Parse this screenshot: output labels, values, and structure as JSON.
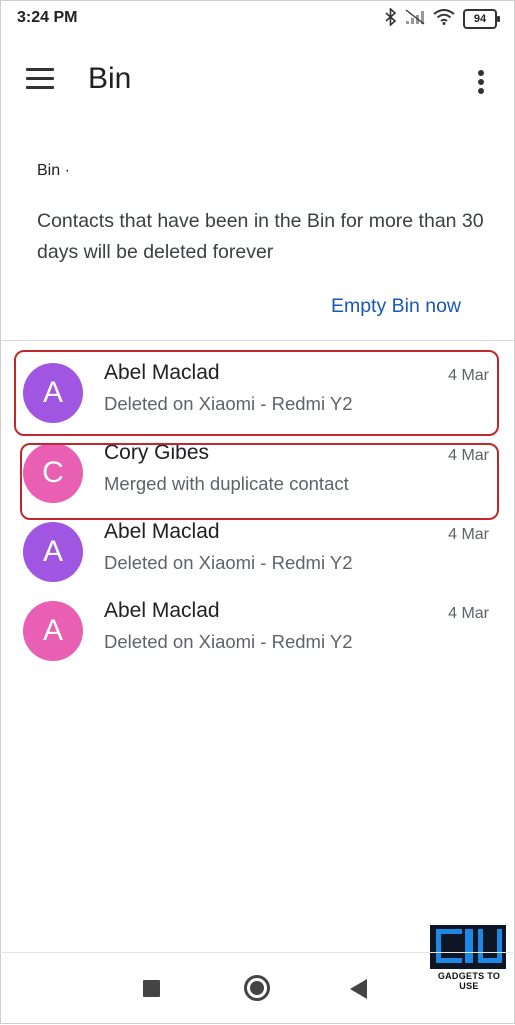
{
  "status_bar": {
    "time": "3:24 PM",
    "battery": "94"
  },
  "app_bar": {
    "title": "Bin"
  },
  "header": {
    "breadcrumb": "Bin ·",
    "info_text": "Contacts that have been in the Bin for more than 30 days will be deleted forever",
    "empty_button": "Empty Bin now"
  },
  "contacts": [
    {
      "initial": "A",
      "name": "Abel Maclad",
      "detail": "Deleted on Xiaomi - Redmi Y2",
      "date": "4 Mar",
      "avatar_color": "#a056e0",
      "highlighted": true
    },
    {
      "initial": "C",
      "name": "Cory Gibes",
      "detail": "Merged with duplicate contact",
      "date": "4 Mar",
      "avatar_color": "#e85fb3",
      "highlighted": true
    },
    {
      "initial": "A",
      "name": "Abel Maclad",
      "detail": "Deleted on Xiaomi - Redmi Y2",
      "date": "4 Mar",
      "avatar_color": "#a056e0",
      "highlighted": false
    },
    {
      "initial": "A",
      "name": "Abel Maclad",
      "detail": "Deleted on Xiaomi - Redmi Y2",
      "date": "4 Mar",
      "avatar_color": "#e85fb3",
      "highlighted": false
    }
  ],
  "watermark": {
    "text": "GADGETS TO USE"
  },
  "icons": {
    "menu": "hamburger-menu-icon",
    "more": "more-vertical-icon",
    "bluetooth": "bluetooth-icon",
    "signal": "signal-icon",
    "wifi": "wifi-icon",
    "nav_recent": "square-icon",
    "nav_home": "circle-icon",
    "nav_back": "triangle-back-icon"
  },
  "colors": {
    "accent": "#1a57b7",
    "highlight_border": "#c0282d"
  }
}
